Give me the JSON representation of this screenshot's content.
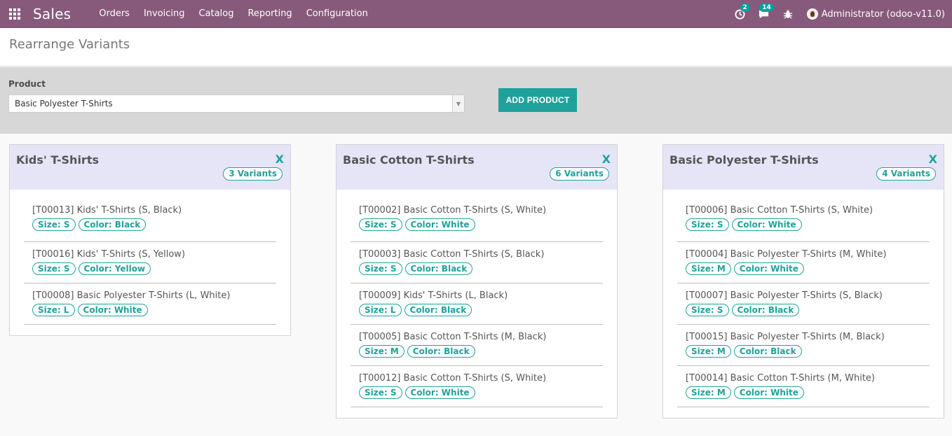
{
  "navbar": {
    "app_name": "Sales",
    "menu": [
      "Orders",
      "Invoicing",
      "Catalog",
      "Reporting",
      "Configuration"
    ],
    "activity_count": "2",
    "messages_count": "14",
    "user": "Administrator (odoo-v11.0)"
  },
  "page": {
    "title": "Rearrange Variants"
  },
  "filter": {
    "product_label": "Product",
    "product_value": "Basic Polyester T-Shirts",
    "add_button": "ADD PRODUCT"
  },
  "columns": [
    {
      "title": "Kids' T-Shirts",
      "close": "X",
      "count": "3 Variants",
      "items": [
        {
          "name": "[T00013] Kids' T-Shirts (S, Black)",
          "tags": [
            "Size: S",
            "Color: Black"
          ]
        },
        {
          "name": "[T00016] Kids' T-Shirts (S, Yellow)",
          "tags": [
            "Size: S",
            "Color: Yellow"
          ]
        },
        {
          "name": "[T00008] Basic Polyester T-Shirts (L, White)",
          "tags": [
            "Size: L",
            "Color: White"
          ]
        }
      ]
    },
    {
      "title": "Basic Cotton T-Shirts",
      "close": "X",
      "count": "6 Variants",
      "items": [
        {
          "name": "[T00002] Basic Cotton T-Shirts (S, White)",
          "tags": [
            "Size: S",
            "Color: White"
          ]
        },
        {
          "name": "[T00003] Basic Cotton T-Shirts (S, Black)",
          "tags": [
            "Size: S",
            "Color: Black"
          ]
        },
        {
          "name": "[T00009] Kids' T-Shirts (L, Black)",
          "tags": [
            "Size: L",
            "Color: Black"
          ]
        },
        {
          "name": "[T00005] Basic Cotton T-Shirts (M, Black)",
          "tags": [
            "Size: M",
            "Color: Black"
          ]
        },
        {
          "name": "[T00012] Basic Cotton T-Shirts (S, White)",
          "tags": [
            "Size: S",
            "Color: White"
          ]
        }
      ]
    },
    {
      "title": "Basic Polyester T-Shirts",
      "close": "X",
      "count": "4 Variants",
      "items": [
        {
          "name": "[T00006] Basic Cotton T-Shirts (S, White)",
          "tags": [
            "Size: S",
            "Color: White"
          ]
        },
        {
          "name": "[T00004] Basic Polyester T-Shirts (M, White)",
          "tags": [
            "Size: M",
            "Color: White"
          ]
        },
        {
          "name": "[T00007] Basic Polyester T-Shirts (S, Black)",
          "tags": [
            "Size: S",
            "Color: Black"
          ]
        },
        {
          "name": "[T00015] Basic Polyester T-Shirts (M, Black)",
          "tags": [
            "Size: M",
            "Color: Black"
          ]
        },
        {
          "name": "[T00014] Basic Cotton T-Shirts (M, White)",
          "tags": [
            "Size: M",
            "Color: White"
          ]
        }
      ]
    }
  ],
  "colors": {
    "navbar": "#875a7b",
    "accent": "#21a19c",
    "column_header": "#e5e5f7"
  },
  "icons": [
    "apps-grid-icon",
    "activity-clock-icon",
    "chat-icon",
    "bug-icon",
    "user-avatar-icon"
  ]
}
